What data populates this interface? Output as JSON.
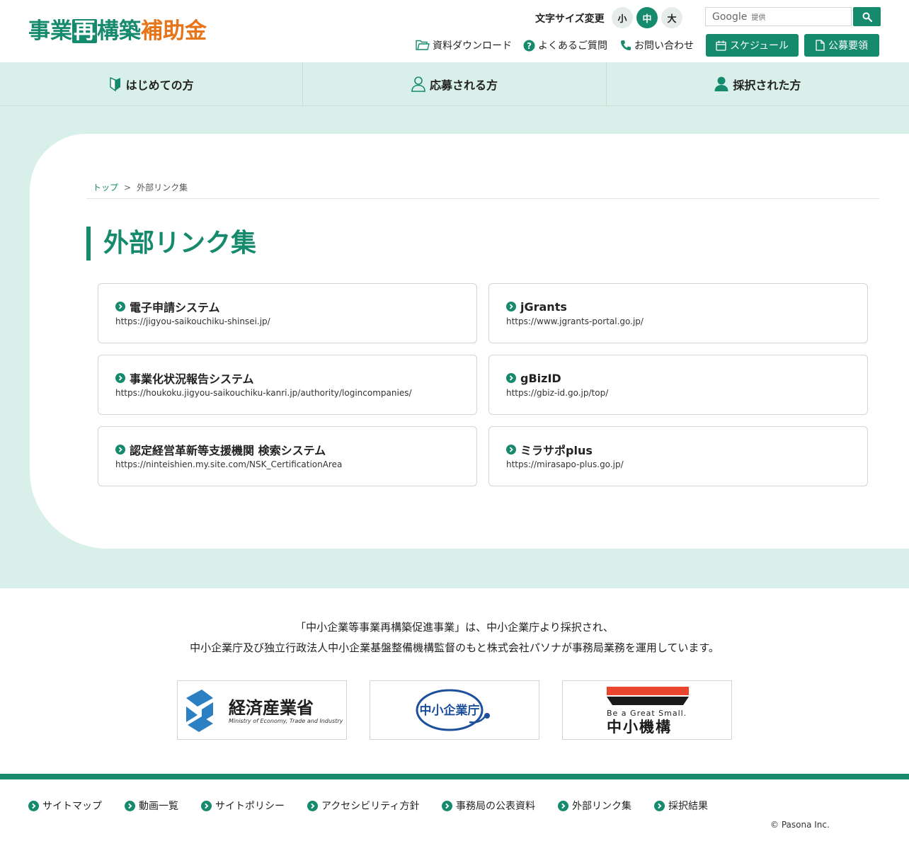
{
  "header": {
    "logo": {
      "part1": "事業",
      "part2": "再",
      "part3": "構築",
      "part4": "補助金"
    },
    "fontsize_label": "文字サイズ変更",
    "fontsize_options": [
      "小",
      "中",
      "大"
    ],
    "fontsize_active": "中",
    "search": {
      "google": "Google",
      "provided": "提供"
    },
    "util_links": [
      "資料ダウンロード",
      "よくあるご質問",
      "お問い合わせ"
    ],
    "buttons": {
      "schedule": "スケジュール",
      "guidelines": "公募要領"
    }
  },
  "nav": {
    "items": [
      "はじめての方",
      "応募される方",
      "採択された方"
    ]
  },
  "breadcrumb": {
    "home": "トップ",
    "separator": ">",
    "current": "外部リンク集"
  },
  "page_title": "外部リンク集",
  "links": [
    {
      "title": "電子申請システム",
      "url": "https://jigyou-saikouchiku-shinsei.jp/"
    },
    {
      "title": "jGrants",
      "url": "https://www.jgrants-portal.go.jp/"
    },
    {
      "title": "事業化状況報告システム",
      "url": "https://houkoku.jigyou-saikouchiku-kanri.jp/authority/logincompanies/"
    },
    {
      "title": "gBizID",
      "url": "https://gbiz-id.go.jp/top/"
    },
    {
      "title": "認定経営革新等支援機関 検索システム",
      "url": "https://ninteishien.my.site.com/NSK_CertificationArea"
    },
    {
      "title": "ミラサポplus",
      "url": "https://mirasapo-plus.go.jp/"
    }
  ],
  "footer": {
    "text_line1": "「中小企業等事業再構築促進事業」は、中小企業庁より採択され、",
    "text_line2": "中小企業庁及び独立行政法人中小企業基盤整備機構監督のもと株式会社パソナが事務局業務を運用しています。",
    "logos": {
      "meti_jp": "経済産業省",
      "meti_en": "Ministry of Economy, Trade and Industry",
      "chusho": "中小企業庁",
      "smrj_tag": "Be a Great Small.",
      "smrj_name": "中小機構"
    },
    "links": [
      "サイトマップ",
      "動画一覧",
      "サイトポリシー",
      "アクセシビリティ方針",
      "事務局の公表資料",
      "外部リンク集",
      "採択結果"
    ],
    "copyright": "© Pasona Inc."
  },
  "colors": {
    "primary": "#168a6c",
    "accent": "#e67418",
    "mint": "#d9f0ea"
  },
  "icons": [
    "folder-icon",
    "question-icon",
    "phone-icon",
    "calendar-icon",
    "document-icon",
    "search-icon",
    "beginner-mark-icon",
    "person-outline-icon",
    "person-filled-icon",
    "chevron-circle-icon"
  ]
}
